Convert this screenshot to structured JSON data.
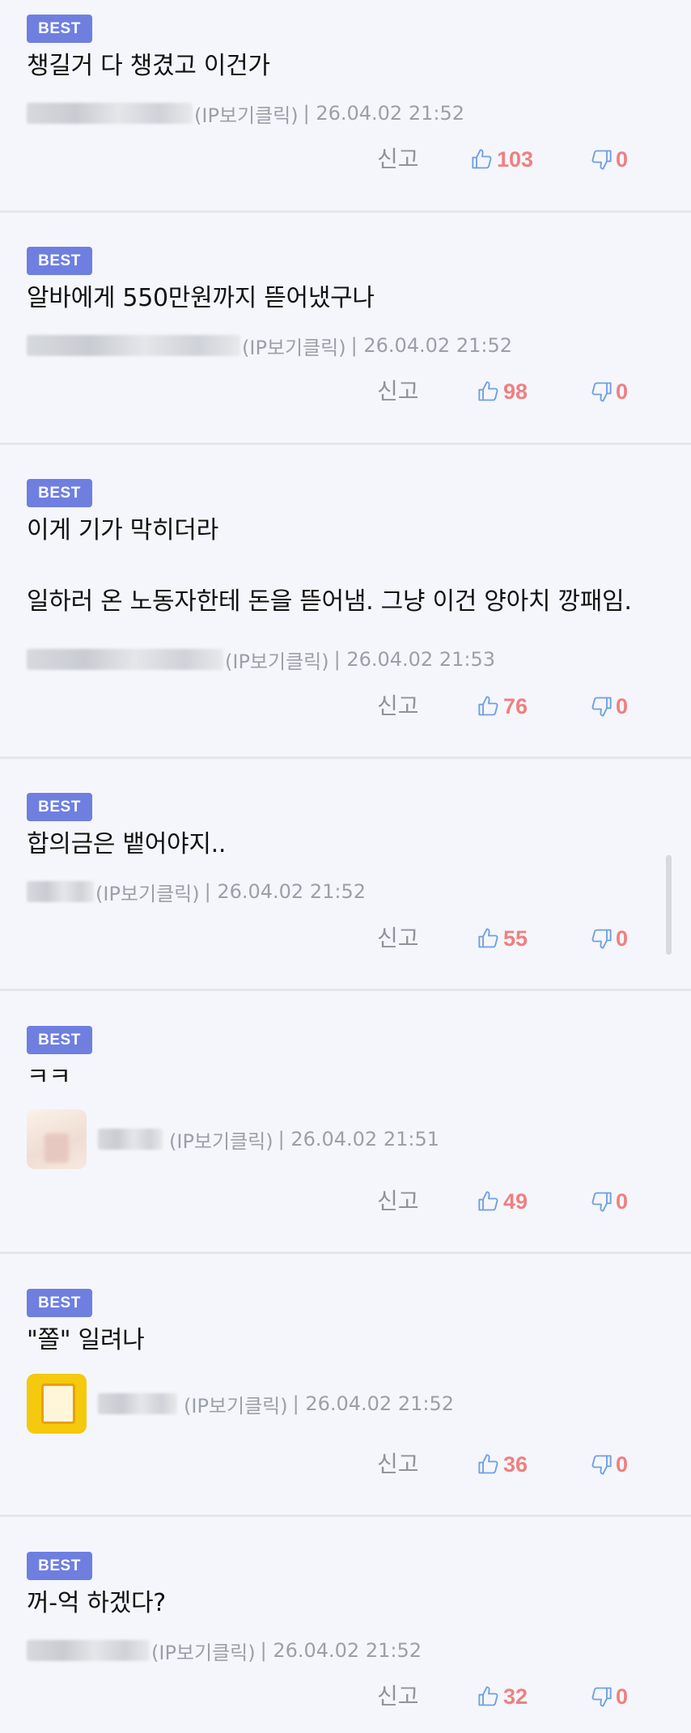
{
  "badge_label": "BEST",
  "report_label": "신고",
  "comments": [
    {
      "text": "챙길거 다 챙겼고 이건가",
      "author_suffix": "",
      "ip_label": "(IP보기클릭)",
      "date": "| 26.04.02 21:52",
      "likes": "103",
      "dislikes": "0"
    },
    {
      "text": "알바에게 550만원까지 뜯어냈구나",
      "author_suffix": "",
      "ip_label": "(IP보기클릭)",
      "date": "| 26.04.02 21:52",
      "likes": "98",
      "dislikes": "0"
    },
    {
      "text": "이게 기가 막히더라\n\n일하러 온 노동자한테 돈을 뜯어냄. 그냥 이건 양아치 깡패임.",
      "author_suffix": "",
      "ip_label": "(IP보기클릭)",
      "date": "| 26.04.02 21:53",
      "likes": "76",
      "dislikes": "0"
    },
    {
      "text": "합의금은 뱉어야지..",
      "author_suffix": "",
      "ip_label": "(IP보기클릭)",
      "date": "| 26.04.02 21:52",
      "likes": "55",
      "dislikes": "0"
    },
    {
      "text": "ㅋㅋ",
      "author_suffix": "",
      "ip_label": "(IP보기클릭)",
      "date": "| 26.04.02 21:51",
      "likes": "49",
      "dislikes": "0"
    },
    {
      "text": "\"쫄\" 일려나",
      "author_suffix": "",
      "ip_label": "(IP보기클릭)",
      "date": "| 26.04.02 21:52",
      "likes": "36",
      "dislikes": "0"
    },
    {
      "text": "꺼-억 하겠다?",
      "author_suffix": "",
      "ip_label": "(IP보기클릭)",
      "date": "| 26.04.02 21:52",
      "likes": "32",
      "dislikes": "0"
    }
  ],
  "colors": {
    "badge": "#6e7fe0",
    "like_icon": "#6f9fe0",
    "count": "#ef8080",
    "meta": "#9ba0a8"
  }
}
